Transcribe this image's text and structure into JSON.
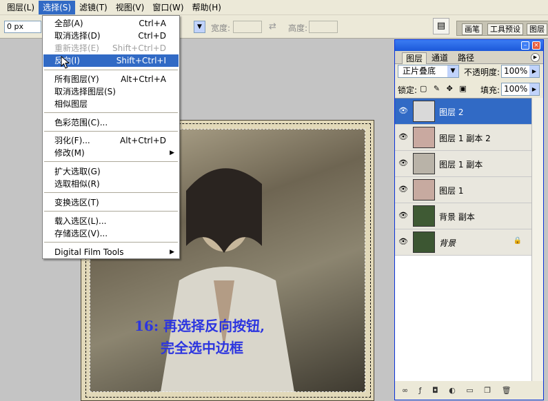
{
  "menubar": {
    "items": [
      {
        "label": "图层(L)"
      },
      {
        "label": "选择(S)"
      },
      {
        "label": "滤镜(T)"
      },
      {
        "label": "视图(V)"
      },
      {
        "label": "窗口(W)"
      },
      {
        "label": "帮助(H)"
      }
    ]
  },
  "options": {
    "feather_value": "0 px",
    "width_label": "宽度:",
    "height_label": "高度:",
    "palette_tabs": [
      "画笔",
      "工具预设",
      "图层"
    ]
  },
  "select_menu": {
    "items": [
      {
        "label": "全部(A)",
        "shortcut": "Ctrl+A",
        "state": "normal"
      },
      {
        "label": "取消选择(D)",
        "shortcut": "Ctrl+D",
        "state": "normal"
      },
      {
        "label": "重新选择(E)",
        "shortcut": "Shift+Ctrl+D",
        "state": "disabled"
      },
      {
        "label": "反向(I)",
        "shortcut": "Shift+Ctrl+I",
        "state": "highlighted"
      },
      {
        "label": "所有图层(Y)",
        "shortcut": "Alt+Ctrl+A",
        "state": "normal"
      },
      {
        "label": "取消选择图层(S)",
        "shortcut": "",
        "state": "normal"
      },
      {
        "label": "相似图层",
        "shortcut": "",
        "state": "normal"
      },
      {
        "label": "色彩范围(C)...",
        "shortcut": "",
        "state": "normal"
      },
      {
        "label": "羽化(F)...",
        "shortcut": "Alt+Ctrl+D",
        "state": "normal"
      },
      {
        "label": "修改(M)",
        "shortcut": "",
        "state": "normal",
        "submenu": true
      },
      {
        "label": "扩大选取(G)",
        "shortcut": "",
        "state": "normal"
      },
      {
        "label": "选取相似(R)",
        "shortcut": "",
        "state": "normal"
      },
      {
        "label": "变换选区(T)",
        "shortcut": "",
        "state": "normal"
      },
      {
        "label": "载入选区(L)...",
        "shortcut": "",
        "state": "normal"
      },
      {
        "label": "存储选区(V)...",
        "shortcut": "",
        "state": "normal"
      },
      {
        "label": "Digital Film Tools",
        "shortcut": "",
        "state": "normal",
        "submenu": true
      }
    ]
  },
  "caption": {
    "line1": "16: 再选择反向按钮,",
    "line2": "完全选中边框"
  },
  "layers_panel": {
    "tabs": [
      "图层",
      "通道",
      "路径"
    ],
    "blend_mode": "正片叠底",
    "opacity_label": "不透明度:",
    "opacity_value": "100%",
    "lock_label": "锁定:",
    "fill_label": "填充:",
    "fill_value": "100%",
    "layers": [
      {
        "name": "图层 2",
        "selected": true,
        "thumb": "#d9d9d9"
      },
      {
        "name": "图层 1 副本 2",
        "selected": false,
        "thumb": "#c9a9a0"
      },
      {
        "name": "图层 1 副本",
        "selected": false,
        "thumb": "#b9b3a8"
      },
      {
        "name": "图层 1",
        "selected": false,
        "thumb": "#c7aaa0"
      },
      {
        "name": "背景 副本",
        "selected": false,
        "thumb": "#3f5a34"
      },
      {
        "name": "背景",
        "selected": false,
        "thumb": "#3c5632",
        "locked": true
      }
    ]
  },
  "colors": {
    "accent": "#316ac5",
    "caption": "#2c35e0",
    "panel_title": "#1c58d9"
  }
}
